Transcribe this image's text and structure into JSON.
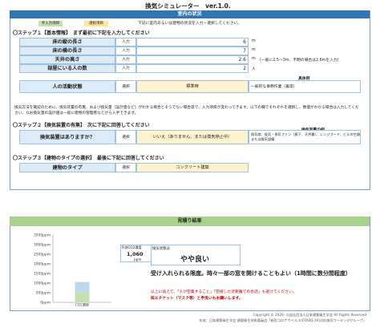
{
  "title": "換気シミュレーター　ver.1.0.",
  "section1": {
    "header": "室内の状況",
    "legend_input": "手入力項目",
    "legend_select": "選択項目",
    "legend_note": "下記に室内あるいは建物の状況を入力・選択してください。"
  },
  "step1": {
    "title": "〇ステップ１【基本情報】　まず最初に下記を入力してください",
    "rows": [
      {
        "label": "床の縦の長さ",
        "type": "入力",
        "value": "6",
        "unit": "m",
        "note": ""
      },
      {
        "label": "床の横の長さ",
        "type": "入力",
        "value": "7",
        "unit": "m",
        "note": ""
      },
      {
        "label": "天井の高さ",
        "type": "入力",
        "value": "2.6",
        "unit": "m",
        "note": "(一般に2.5～3m、不明の場合は2.6mを入力)"
      },
      {
        "label": "部屋にいる人の数",
        "type": "入力",
        "value": "2",
        "unit": "人",
        "note": ""
      }
    ],
    "activity": {
      "label": "人の活動状態",
      "type": "選択",
      "value": "標準時",
      "example_header": "具体例",
      "example": "一般的な事務作業（着席）"
    }
  },
  "step_note": "換気方法を確認のために、換気装置の有無、および換気量（設計値など）がわかる場合とそうでない場合等で、入力項目が変わってきます。以下の欄でそれぞれを選択し、数値がわかる場合は入力してください。なお換気量の設計値は一般に建物の管理者などから入手できます。",
  "step2": {
    "title": "〇ステップ２【換気装置の有無】　次に下記に回答してください",
    "label": "換気装置はありますか？",
    "type": "選択",
    "value": "いいえ（ありません、または換気停止中）",
    "example_header": "換気装置の例",
    "example": "換気扇、吸気・排気ファン（廊下、天井裏）、レンジフード、ビルの空調または換気設備"
  },
  "step3": {
    "title": "〇ステップ３【建物のタイプの選択】　最後に下記に回答してください",
    "label": "建物のタイプ",
    "type": "選択",
    "value": "コンクリート建築"
  },
  "section2": {
    "header": "見積り結果",
    "co2_label": "予測CO2濃度",
    "co2_value": "1,060",
    "co2_unit": "ppm",
    "state_label": "換気状態は",
    "state_value": "やや良い",
    "message": "受け入れられる限度。時々一部の窓を開けることもよい（1時間に数分間程度）",
    "caution1": "以上に加えて、「人が密集すること」「密接した近距離での会話」も避けてください。",
    "caution2": "咳エチケット（マスク等）と手洗いもお願いします。"
  },
  "chart_data": {
    "type": "bar",
    "categories": [
      "CO2濃度"
    ],
    "values": [
      1060
    ],
    "ylim": [
      0,
      3500
    ],
    "yticks": [
      "3500ppm",
      "3000ppm",
      "2500ppm",
      "2000ppm",
      "1500ppm",
      "1000ppm",
      "500ppm",
      "0ppm"
    ],
    "xlabel": "",
    "ylabel": "",
    "title": ""
  },
  "footer": {
    "copyright": "Copyright © 2020- 公益社団法人日本建築衛生学会 All Rights Reserved",
    "credit": "作成：日本建築衛生学会 建築衛生技術委員会「新型コロナウイルス(COVID-19)対応換気ワーキンググループ」"
  },
  "colors": {
    "header_blue": "#2e75b6",
    "label_blue": "#ddebf7",
    "input_green": "#c6e0b4",
    "select_yellow": "#ffe699",
    "result_green": "#a9d18e",
    "bar_bottom": "#c6e0b4",
    "bar_top": "#bdd7ee",
    "caution_red": "#c00000"
  }
}
